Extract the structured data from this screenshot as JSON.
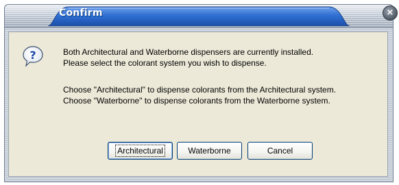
{
  "window": {
    "title": "Confirm",
    "close_glyph": "×"
  },
  "message": {
    "line1": "Both Architectural and Waterborne dispensers are currently installed.",
    "line2": "Please select the colorant system you wish to dispense.",
    "line3": "Choose \"Architectural\" to dispense colorants from the Architectural system.",
    "line4": "Choose \"Waterborne\" to dispense colorants from the Waterborne system."
  },
  "icon": {
    "name": "question-icon",
    "glyph": "?"
  },
  "buttons": {
    "architectural": "Architectural",
    "waterborne": "Waterborne",
    "cancel": "Cancel"
  },
  "colors": {
    "title_blue": "#2a66c9",
    "panel": "#ece9d8",
    "button_border": "#003c74"
  }
}
